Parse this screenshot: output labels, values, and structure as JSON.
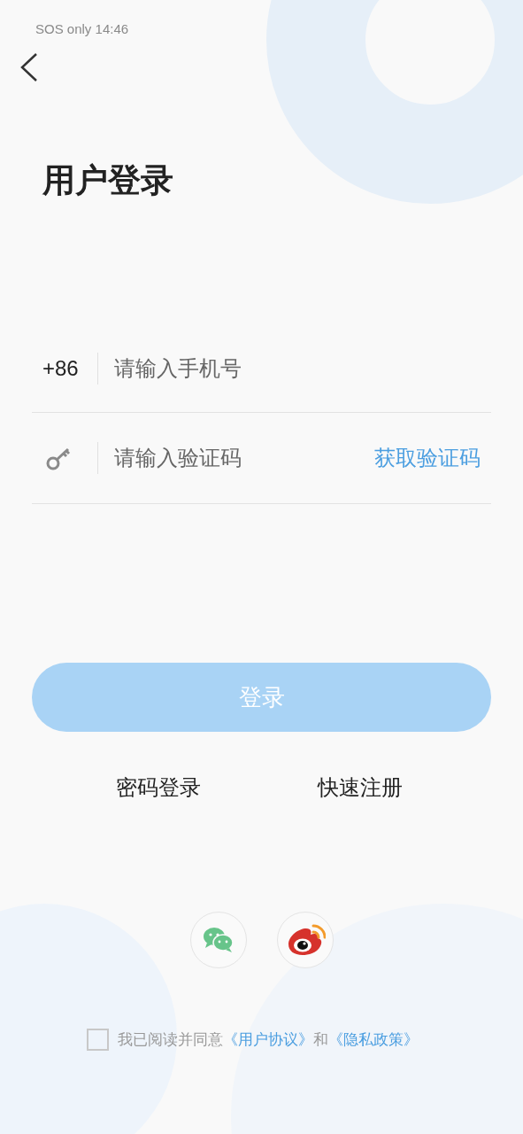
{
  "status_bar": {
    "carrier": "SOS only",
    "time": "14:46"
  },
  "title": "用户登录",
  "phone": {
    "prefix": "+86",
    "placeholder": "请输入手机号"
  },
  "code": {
    "placeholder": "请输入验证码",
    "get_code": "获取验证码"
  },
  "login_button": {
    "label": "登录",
    "disabled": true
  },
  "links": [
    "密码登录",
    "快速注册"
  ],
  "social": [
    {
      "kind": "wechat"
    },
    {
      "kind": "weibo"
    }
  ],
  "agreement": {
    "checked": false,
    "text": "我已阅读并同意",
    "link1": "《用户协议》",
    "joiner": "和",
    "link2": "《隐私政策》"
  }
}
